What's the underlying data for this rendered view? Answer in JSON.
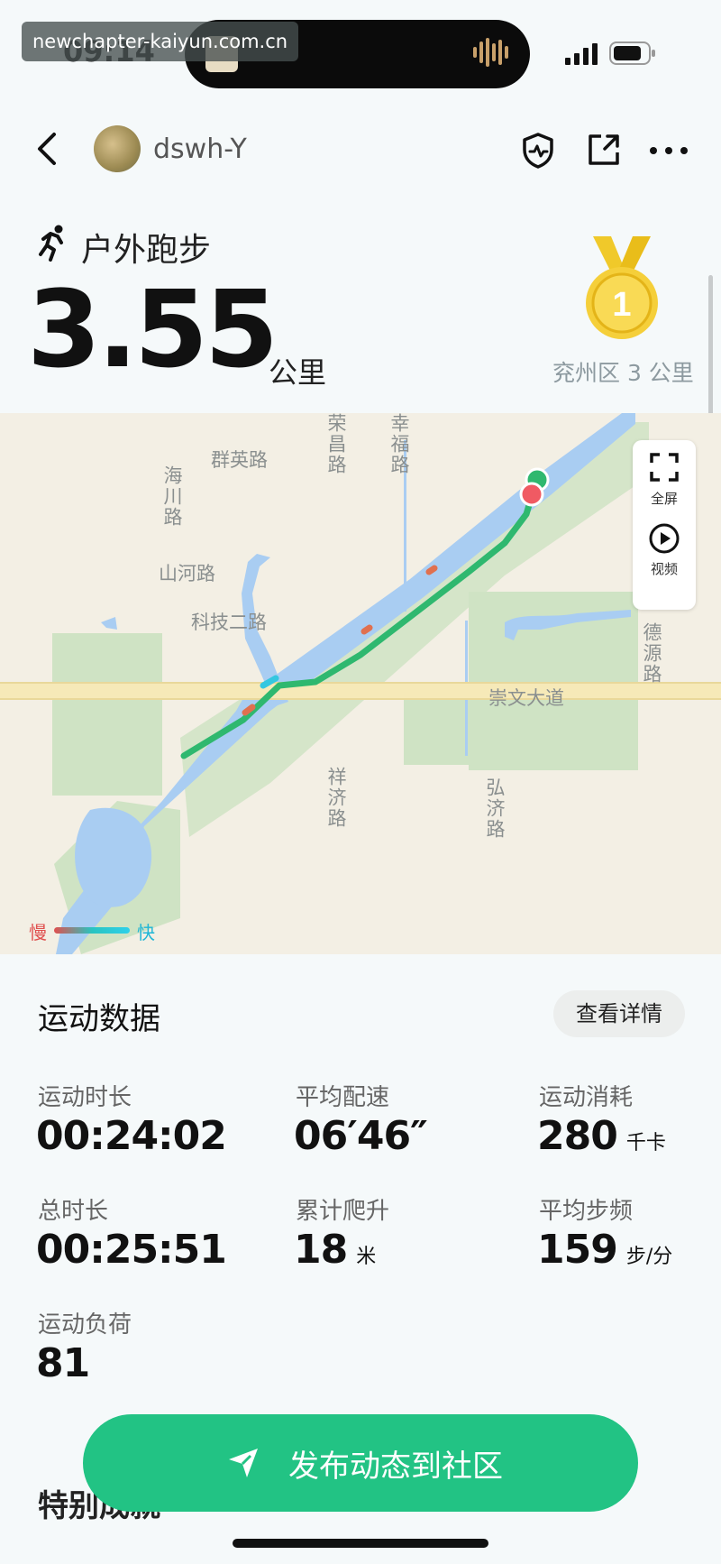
{
  "status_bar": {
    "time": "09:14",
    "watermark": "newchapter-kaiyun.com.cn"
  },
  "header": {
    "username": "dswh-Y"
  },
  "activity": {
    "type": "户外跑步",
    "distance": "3.55",
    "distance_unit": "公里",
    "medal_number": "1",
    "medal_caption": "兖州区 3 公里"
  },
  "map": {
    "roads": {
      "qunying": "群英路",
      "rongchang": "荣昌路",
      "xingfu": "幸福路",
      "haichuan": "海川路",
      "shanhe": "山河路",
      "keji2": "科技二路",
      "deyuan": "德源路",
      "chongwen": "崇文大道",
      "xiangji": "祥济路",
      "hongji": "弘济路"
    },
    "controls": {
      "fullscreen": "全屏",
      "video": "视频"
    },
    "legend": {
      "slow": "慢",
      "fast": "快"
    },
    "colors": {
      "route": "#2fb86f",
      "water": "#a9cdf2",
      "park": "#cfe3c4",
      "end_marker": "#f05a63"
    }
  },
  "stats": {
    "section_title": "运动数据",
    "details_button": "查看详情",
    "items": [
      {
        "label": "运动时长",
        "value": "00:24:02",
        "unit": ""
      },
      {
        "label": "平均配速",
        "value": "06′46″",
        "unit": ""
      },
      {
        "label": "运动消耗",
        "value": "280",
        "unit": "千卡"
      },
      {
        "label": "总时长",
        "value": "00:25:51",
        "unit": ""
      },
      {
        "label": "累计爬升",
        "value": "18",
        "unit": "米"
      },
      {
        "label": "平均步频",
        "value": "159",
        "unit": "步/分"
      },
      {
        "label": "运动负荷",
        "value": "81",
        "unit": ""
      }
    ]
  },
  "footer": {
    "publish_button": "发布动态到社区",
    "special_title": "特别成就"
  },
  "accent": "#22c384"
}
